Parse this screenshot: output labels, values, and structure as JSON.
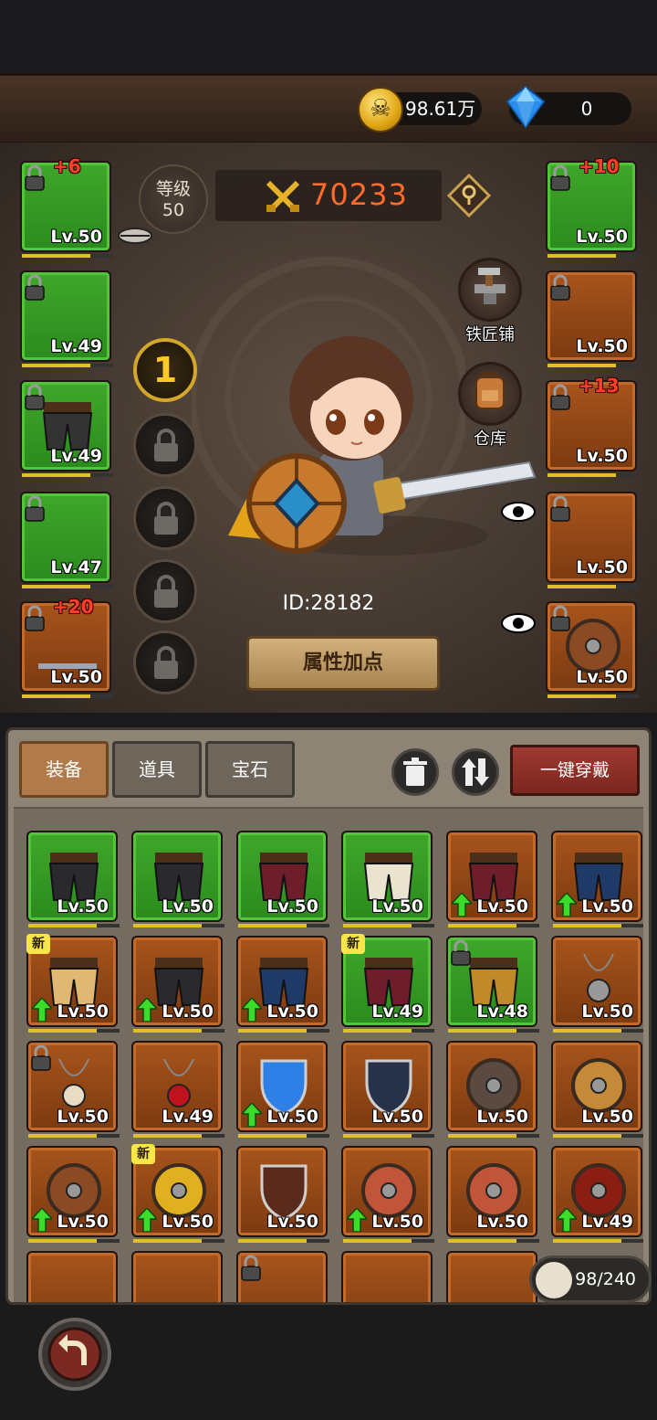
{
  "currency": {
    "gold": "98.61万",
    "gems": "0"
  },
  "character": {
    "level_label": "等级",
    "level": "50",
    "power": "70233",
    "id_text": "ID:28182",
    "attr_button": "属性加点",
    "blacksmith": "铁匠铺",
    "warehouse": "仓库",
    "skill_slot_active": "1"
  },
  "left_slots": [
    {
      "lv": "Lv.50",
      "plus": "+6",
      "color": "green"
    },
    {
      "lv": "Lv.49",
      "plus": "",
      "color": "green"
    },
    {
      "lv": "Lv.49",
      "plus": "",
      "color": "green"
    },
    {
      "lv": "Lv.47",
      "plus": "",
      "color": "green"
    },
    {
      "lv": "Lv.50",
      "plus": "+20",
      "color": "brown"
    }
  ],
  "right_slots": [
    {
      "lv": "Lv.50",
      "plus": "+10",
      "color": "green"
    },
    {
      "lv": "Lv.50",
      "plus": "",
      "color": "brown"
    },
    {
      "lv": "Lv.50",
      "plus": "+13",
      "color": "brown"
    },
    {
      "lv": "Lv.50",
      "plus": "",
      "color": "brown"
    },
    {
      "lv": "Lv.50",
      "plus": "",
      "color": "brown"
    }
  ],
  "bag": {
    "tabs": [
      "装备",
      "道具",
      "宝石"
    ],
    "equip_all": "一键穿戴",
    "count": "98/240",
    "new_label": "新",
    "items": [
      {
        "lv": "Lv.50",
        "color": "green",
        "new": false,
        "up": false,
        "lock": false,
        "kind": "pants-dark"
      },
      {
        "lv": "Lv.50",
        "color": "green",
        "new": false,
        "up": false,
        "lock": false,
        "kind": "pants-dark"
      },
      {
        "lv": "Lv.50",
        "color": "green",
        "new": false,
        "up": false,
        "lock": false,
        "kind": "pants-red"
      },
      {
        "lv": "Lv.50",
        "color": "green",
        "new": false,
        "up": false,
        "lock": false,
        "kind": "pants-white"
      },
      {
        "lv": "Lv.50",
        "color": "brown",
        "new": false,
        "up": true,
        "lock": false,
        "kind": "pants-red"
      },
      {
        "lv": "Lv.50",
        "color": "brown",
        "new": false,
        "up": true,
        "lock": false,
        "kind": "pants-blue"
      },
      {
        "lv": "Lv.50",
        "color": "brown",
        "new": true,
        "up": true,
        "lock": false,
        "kind": "pants-tan"
      },
      {
        "lv": "Lv.50",
        "color": "brown",
        "new": false,
        "up": true,
        "lock": false,
        "kind": "pants-dark"
      },
      {
        "lv": "Lv.50",
        "color": "brown",
        "new": false,
        "up": true,
        "lock": false,
        "kind": "pants-blue"
      },
      {
        "lv": "Lv.49",
        "color": "green",
        "new": true,
        "up": false,
        "lock": false,
        "kind": "pants-red"
      },
      {
        "lv": "Lv.48",
        "color": "green",
        "new": false,
        "up": false,
        "lock": true,
        "kind": "pants-gold"
      },
      {
        "lv": "Lv.50",
        "color": "brown",
        "new": false,
        "up": false,
        "lock": false,
        "kind": "necklace-cross"
      },
      {
        "lv": "Lv.50",
        "color": "brown",
        "new": false,
        "up": false,
        "lock": true,
        "kind": "necklace-skull"
      },
      {
        "lv": "Lv.49",
        "color": "brown",
        "new": false,
        "up": false,
        "lock": false,
        "kind": "necklace-red"
      },
      {
        "lv": "Lv.50",
        "color": "brown",
        "new": false,
        "up": true,
        "lock": false,
        "kind": "shield-blue"
      },
      {
        "lv": "Lv.50",
        "color": "brown",
        "new": false,
        "up": false,
        "lock": false,
        "kind": "shield-star"
      },
      {
        "lv": "Lv.50",
        "color": "brown",
        "new": false,
        "up": false,
        "lock": false,
        "kind": "shield-round-dark"
      },
      {
        "lv": "Lv.50",
        "color": "brown",
        "new": false,
        "up": false,
        "lock": false,
        "kind": "shield-round-gold"
      },
      {
        "lv": "Lv.50",
        "color": "brown",
        "new": false,
        "up": true,
        "lock": false,
        "kind": "shield-round-brown"
      },
      {
        "lv": "Lv.50",
        "color": "brown",
        "new": true,
        "up": true,
        "lock": false,
        "kind": "shield-compass"
      },
      {
        "lv": "Lv.50",
        "color": "brown",
        "new": false,
        "up": false,
        "lock": false,
        "kind": "shield-kite"
      },
      {
        "lv": "Lv.50",
        "color": "brown",
        "new": false,
        "up": true,
        "lock": false,
        "kind": "shield-round-red"
      },
      {
        "lv": "Lv.50",
        "color": "brown",
        "new": false,
        "up": false,
        "lock": false,
        "kind": "shield-round-red"
      },
      {
        "lv": "Lv.49",
        "color": "brown",
        "new": false,
        "up": true,
        "lock": false,
        "kind": "shield-fire"
      },
      {
        "lv": "",
        "color": "brown",
        "new": false,
        "up": false,
        "lock": false,
        "kind": "weapon"
      },
      {
        "lv": "",
        "color": "brown",
        "new": false,
        "up": false,
        "lock": false,
        "kind": "weapon"
      },
      {
        "lv": "",
        "color": "brown",
        "new": false,
        "up": false,
        "lock": true,
        "kind": "weapon"
      },
      {
        "lv": "",
        "color": "brown",
        "new": false,
        "up": false,
        "lock": false,
        "kind": "weapon"
      },
      {
        "lv": "",
        "color": "brown",
        "new": false,
        "up": false,
        "lock": false,
        "kind": "weapon"
      }
    ]
  },
  "colors": {
    "green": "#3fa72a",
    "brown": "#a7541c",
    "power": "#ff6b2a",
    "equip_all": "#9e3a30"
  }
}
